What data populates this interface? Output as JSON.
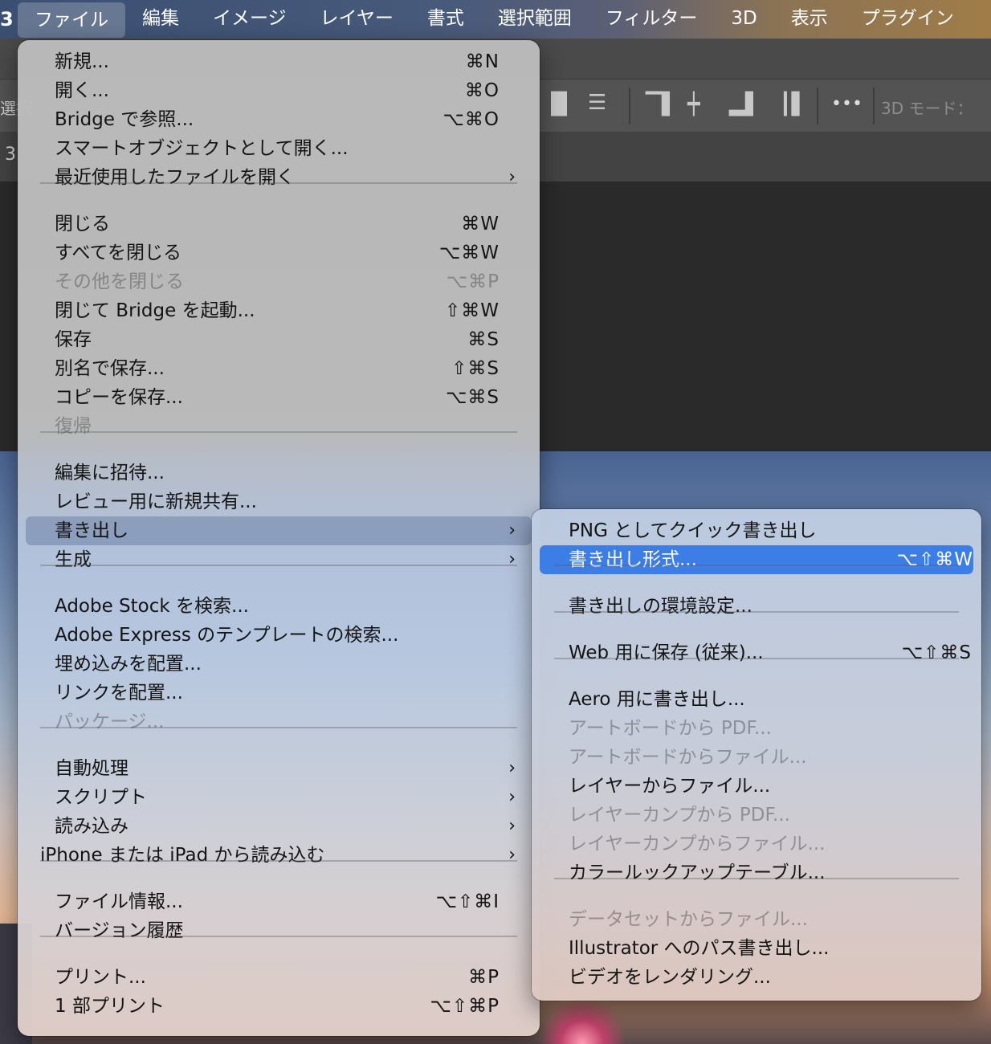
{
  "menubar": {
    "app_fragment": "3",
    "items": [
      "ファイル",
      "編集",
      "イメージ",
      "レイヤー",
      "書式",
      "選択範囲",
      "フィルター",
      "3D",
      "表示",
      "プラグイン"
    ]
  },
  "options_bar": {
    "left_fragment": "選択",
    "more_glyph": "•••",
    "mode_label": "3D モード："
  },
  "doc_tab_fragment": "3",
  "file_menu": {
    "groups": [
      [
        {
          "label": "新規...",
          "shortcut": "⌘N",
          "enabled": true
        },
        {
          "label": "開く...",
          "shortcut": "⌘O",
          "enabled": true
        },
        {
          "label": "Bridge で参照...",
          "shortcut": "⌥⌘O",
          "enabled": true
        },
        {
          "label": "スマートオブジェクトとして開く...",
          "shortcut": "",
          "enabled": true
        },
        {
          "label": "最近使用したファイルを開く",
          "shortcut": "",
          "submenu": true,
          "enabled": true
        }
      ],
      [
        {
          "label": "閉じる",
          "shortcut": "⌘W",
          "enabled": true
        },
        {
          "label": "すべてを閉じる",
          "shortcut": "⌥⌘W",
          "enabled": true
        },
        {
          "label": "その他を閉じる",
          "shortcut": "⌥⌘P",
          "enabled": false
        },
        {
          "label": "閉じて Bridge を起動...",
          "shortcut": "⇧⌘W",
          "enabled": true
        },
        {
          "label": "保存",
          "shortcut": "⌘S",
          "enabled": true
        },
        {
          "label": "別名で保存...",
          "shortcut": "⇧⌘S",
          "enabled": true
        },
        {
          "label": "コピーを保存...",
          "shortcut": "⌥⌘S",
          "enabled": true
        },
        {
          "label": "復帰",
          "shortcut": "",
          "enabled": false
        }
      ],
      [
        {
          "label": "編集に招待...",
          "shortcut": "",
          "enabled": true
        },
        {
          "label": "レビュー用に新規共有...",
          "shortcut": "",
          "enabled": true
        },
        {
          "label": "書き出し",
          "shortcut": "",
          "submenu": true,
          "enabled": true,
          "highlighted": true
        },
        {
          "label": "生成",
          "shortcut": "",
          "submenu": true,
          "enabled": true
        }
      ],
      [
        {
          "label": "Adobe Stock を検索...",
          "shortcut": "",
          "enabled": true
        },
        {
          "label": "Adobe Express のテンプレートの検索...",
          "shortcut": "",
          "enabled": true
        },
        {
          "label": "埋め込みを配置...",
          "shortcut": "",
          "enabled": true
        },
        {
          "label": "リンクを配置...",
          "shortcut": "",
          "enabled": true
        },
        {
          "label": "パッケージ...",
          "shortcut": "",
          "enabled": false
        }
      ],
      [
        {
          "label": "自動処理",
          "shortcut": "",
          "submenu": true,
          "enabled": true
        },
        {
          "label": "スクリプト",
          "shortcut": "",
          "submenu": true,
          "enabled": true
        },
        {
          "label": "読み込み",
          "shortcut": "",
          "submenu": true,
          "enabled": true
        },
        {
          "label": "iPhone または iPad から読み込む",
          "shortcut": "",
          "submenu": true,
          "enabled": true
        }
      ],
      [
        {
          "label": "ファイル情報...",
          "shortcut": "⌥⇧⌘I",
          "enabled": true
        },
        {
          "label": "バージョン履歴",
          "shortcut": "",
          "enabled": true
        }
      ],
      [
        {
          "label": "プリント...",
          "shortcut": "⌘P",
          "enabled": true
        },
        {
          "label": "1 部プリント",
          "shortcut": "⌥⇧⌘P",
          "enabled": true
        }
      ]
    ]
  },
  "export_submenu": {
    "groups": [
      [
        {
          "label": "PNG としてクイック書き出し",
          "shortcut": "",
          "enabled": true
        },
        {
          "label": "書き出し形式...",
          "shortcut": "⌥⇧⌘W",
          "enabled": true,
          "selected": true
        }
      ],
      [
        {
          "label": "書き出しの環境設定...",
          "shortcut": "",
          "enabled": true
        }
      ],
      [
        {
          "label": "Web 用に保存 (従来)...",
          "shortcut": "⌥⇧⌘S",
          "enabled": true
        }
      ],
      [
        {
          "label": "Aero 用に書き出し...",
          "shortcut": "",
          "enabled": true
        },
        {
          "label": "アートボードから PDF...",
          "shortcut": "",
          "enabled": false
        },
        {
          "label": "アートボードからファイル...",
          "shortcut": "",
          "enabled": false
        },
        {
          "label": "レイヤーからファイル...",
          "shortcut": "",
          "enabled": true
        },
        {
          "label": "レイヤーカンプから PDF...",
          "shortcut": "",
          "enabled": false
        },
        {
          "label": "レイヤーカンプからファイル...",
          "shortcut": "",
          "enabled": false
        },
        {
          "label": "カラールックアップテーブル...",
          "shortcut": "",
          "enabled": true
        }
      ],
      [
        {
          "label": "データセットからファイル...",
          "shortcut": "",
          "enabled": false
        },
        {
          "label": "Illustrator へのパス書き出し...",
          "shortcut": "",
          "enabled": true
        },
        {
          "label": "ビデオをレンダリング...",
          "shortcut": "",
          "enabled": true
        }
      ]
    ]
  },
  "colors": {
    "selection": "#3d7ee6",
    "highlight": "#6e82a5",
    "menubar_left": "#3b4f73",
    "menubar_right": "#a07c48"
  }
}
